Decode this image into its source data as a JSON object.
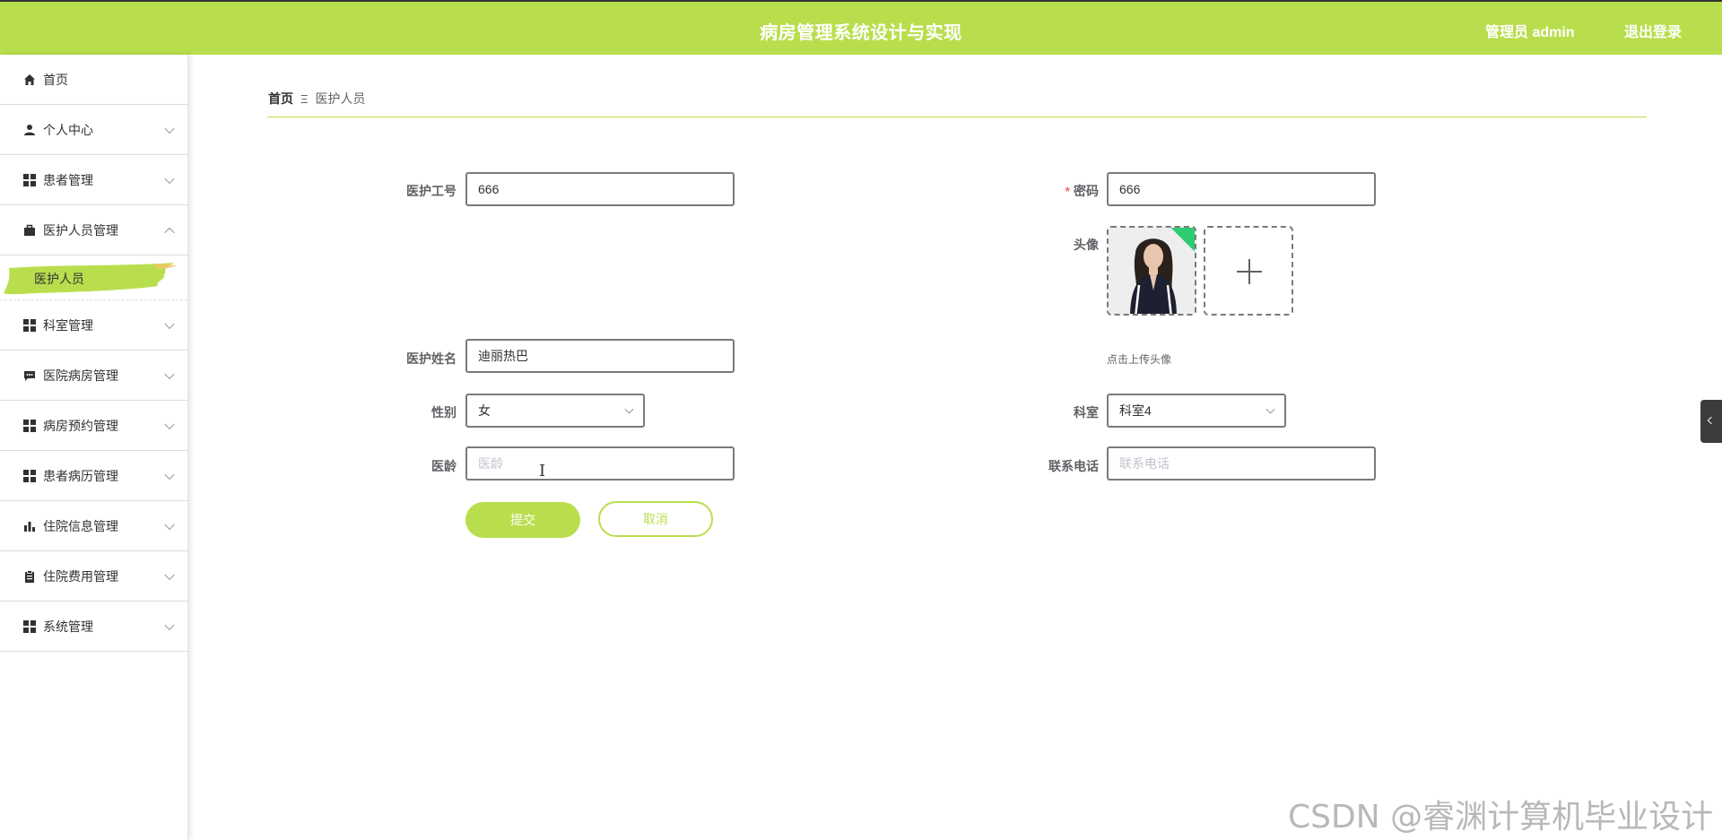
{
  "header": {
    "title": "病房管理系统设计与实现",
    "user": "管理员 admin",
    "logout": "退出登录",
    "accent_color": "#b9de4d"
  },
  "sidebar": {
    "items": [
      {
        "label": "首页",
        "icon": "home-icon"
      },
      {
        "label": "个人中心",
        "icon": "user-icon"
      },
      {
        "label": "患者管理",
        "icon": "grid-icon"
      },
      {
        "label": "医护人员管理",
        "icon": "briefcase-icon",
        "expanded": true
      },
      {
        "label": "科室管理",
        "icon": "grid-icon"
      },
      {
        "label": "医院病房管理",
        "icon": "chat-icon"
      },
      {
        "label": "病房预约管理",
        "icon": "grid-icon"
      },
      {
        "label": "患者病历管理",
        "icon": "grid-icon"
      },
      {
        "label": "住院信息管理",
        "icon": "bar-chart-icon"
      },
      {
        "label": "住院费用管理",
        "icon": "clipboard-icon"
      },
      {
        "label": "系统管理",
        "icon": "grid-icon"
      }
    ],
    "active_sub": "医护人员"
  },
  "breadcrumb": {
    "home": "首页",
    "separator": "Ξ",
    "current": "医护人员"
  },
  "form": {
    "staff_id": {
      "label": "医护工号",
      "value": "666"
    },
    "password": {
      "label": "密码",
      "required_mark": "*",
      "value": "666"
    },
    "avatar": {
      "label": "头像",
      "hint": "点击上传头像"
    },
    "name": {
      "label": "医护姓名",
      "value": "迪丽热巴"
    },
    "gender": {
      "label": "性别",
      "value": "女"
    },
    "department": {
      "label": "科室",
      "value": "科室4"
    },
    "seniority": {
      "label": "医龄",
      "placeholder": "医龄"
    },
    "phone": {
      "label": "联系电话",
      "placeholder": "联系电话"
    },
    "submit": "提交",
    "cancel": "取消"
  },
  "watermark": "CSDN @睿渊计算机毕业设计"
}
